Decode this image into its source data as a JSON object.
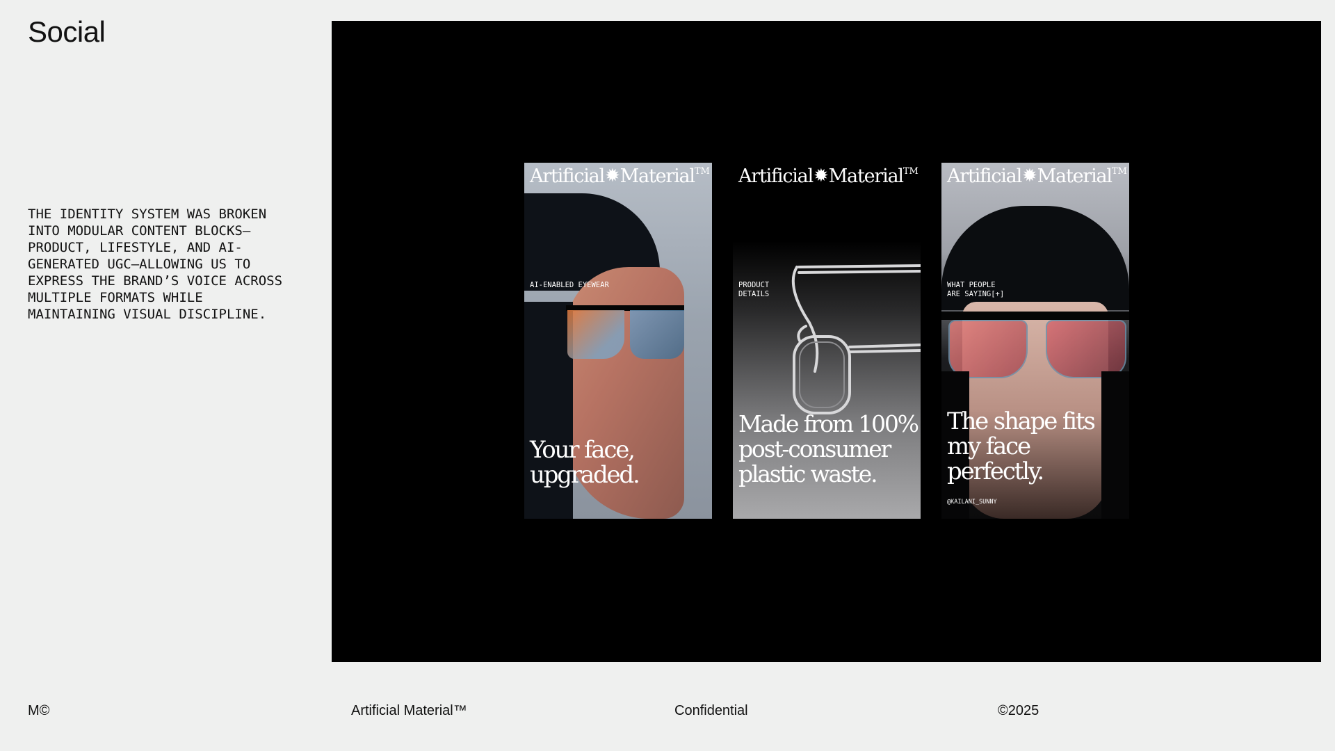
{
  "page": {
    "title": "Social",
    "description": "The identity system was broken into modular content blocks—product, lifestyle, and AI-generated UGC—allowing us to express the brand’s voice across multiple formats while maintaining visual discipline."
  },
  "brand": {
    "name_left": "Artificial",
    "star": "✹",
    "name_right": "Material",
    "trademark": "TM"
  },
  "cards": [
    {
      "tag": "AI-ENABLED EYEWEAR",
      "headline": "Your face,\nupgraded."
    },
    {
      "tag": "PRODUCT\nDETAILS",
      "headline": "Made from 100%\npost-consumer\nplastic waste."
    },
    {
      "tag": "WHAT PEOPLE\nARE SAYING[+]",
      "headline": "The shape fits\nmy face\nperfectly.",
      "handle": "@KAILANI_SUNNY"
    }
  ],
  "footer": {
    "mark": "M©",
    "brand": "Artificial Material™",
    "label": "Confidential",
    "year": "©2025"
  },
  "colors": {
    "background": "#eff0ef",
    "stage": "#000000",
    "text": "#111111"
  }
}
